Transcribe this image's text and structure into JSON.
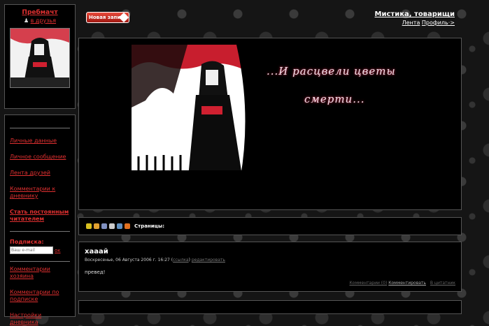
{
  "profile": {
    "username": "Пребмачт",
    "add_friend": "в друзья"
  },
  "menu": {
    "items": [
      "Личные данные",
      "Личное сообщение",
      "Лента друзей",
      "Комментарии к дневнику"
    ],
    "subscribe_reader": "Стать постоянным читателем",
    "subscribe_title": "Подписка:",
    "email_placeholder": "Ваш e-mail",
    "ok": "ок",
    "items_bottom": [
      "Комментарии хозяина",
      "Комментарии по подписке",
      "Настройки дневника"
    ]
  },
  "header": {
    "new_post": "Новая запись",
    "diary_title": "Мистика, товарищи",
    "feed": "Лента",
    "profile": "Профиль·>"
  },
  "banner": {
    "line1": "...И расцвели цветы",
    "line2": "смерти..."
  },
  "toolbar": {
    "pages_label": "Страницы:"
  },
  "post": {
    "title": "хааай",
    "date": "Воскресенье, 06 Августа 2006 г. 16:27",
    "link1": "ссылка",
    "edit": "редактировать",
    "body": "превед!",
    "footer": {
      "comments": "Комментарии (0)",
      "comment": "Комментировать",
      "quote": "В цитатник"
    }
  },
  "colors": {
    "accent": "#e03030",
    "background": "#151515",
    "panel": "#000000"
  }
}
